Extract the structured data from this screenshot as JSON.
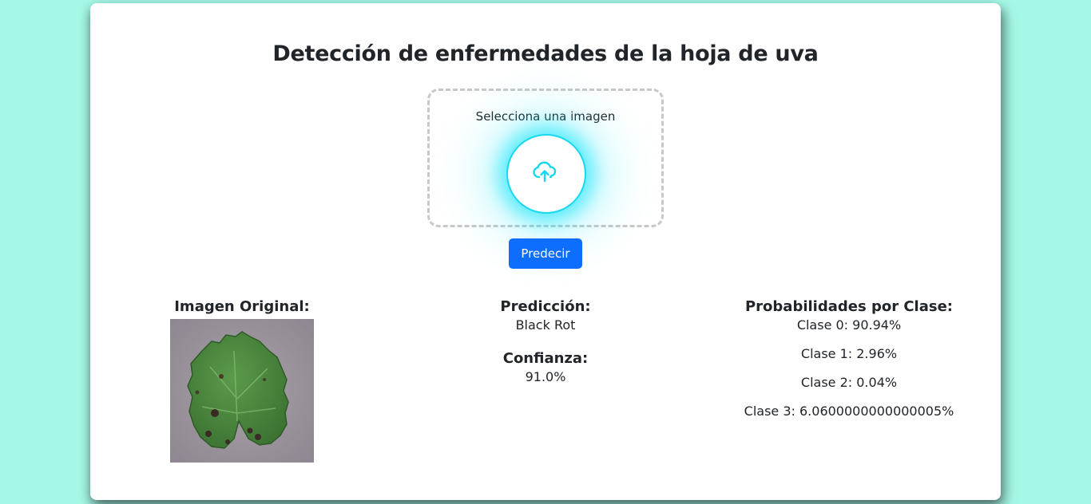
{
  "page": {
    "title": "Detección de enfermedades de la hoja de uva"
  },
  "upload": {
    "label": "Selecciona una imagen",
    "icon": "cloud-upload-icon",
    "accent_color": "#17d8f0"
  },
  "predict_button": {
    "label": "Predecir",
    "color": "#0d6efd"
  },
  "original": {
    "heading": "Imagen Original:"
  },
  "prediction": {
    "heading": "Predicción:",
    "value": "Black Rot",
    "confidence_heading": "Confianza:",
    "confidence_value": "91.0%"
  },
  "probabilities": {
    "heading": "Probabilidades por Clase:",
    "items": [
      "Clase 0: 90.94%",
      "Clase 1: 2.96%",
      "Clase 2: 0.04%",
      "Clase 3: 6.0600000000000005%"
    ]
  },
  "colors": {
    "background": "#a6f8e6",
    "card": "#ffffff"
  }
}
